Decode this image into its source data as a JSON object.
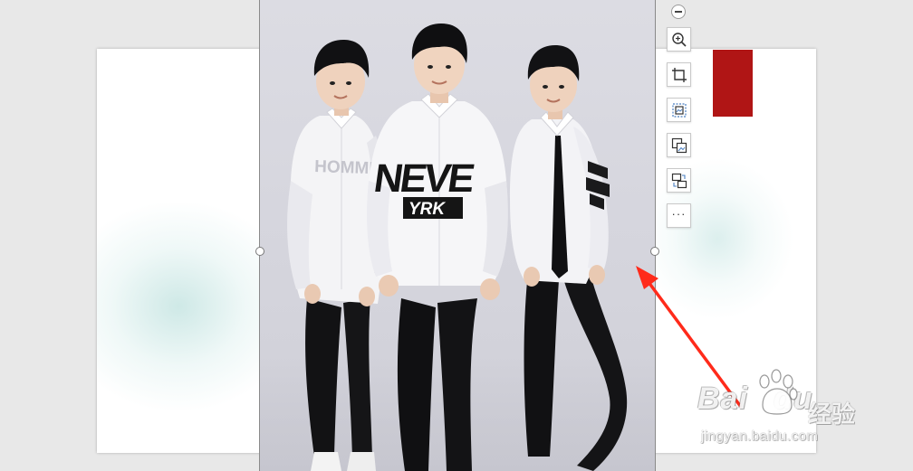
{
  "photo": {
    "shirt_text_left": "HOMME",
    "shirt_text_center_top": "NEVE",
    "shirt_text_center_bottom": "YRK"
  },
  "toolbar": {
    "collapse_icon": "minus-circle-icon",
    "items": [
      {
        "icon": "zoom-in-icon"
      },
      {
        "icon": "crop-icon"
      },
      {
        "icon": "fit-frame-icon"
      },
      {
        "icon": "replace-image-icon"
      },
      {
        "icon": "image-swap-icon"
      },
      {
        "icon": "more-icon",
        "label": "···"
      }
    ]
  },
  "annotation": {
    "arrow_color": "#ff2a1a"
  },
  "slide": {
    "red_block_color": "#b01515"
  },
  "watermark": {
    "logo_text": "Bai",
    "logo_suffix": "du",
    "cn_text": "经验",
    "url": "jingyan.baidu.com"
  }
}
